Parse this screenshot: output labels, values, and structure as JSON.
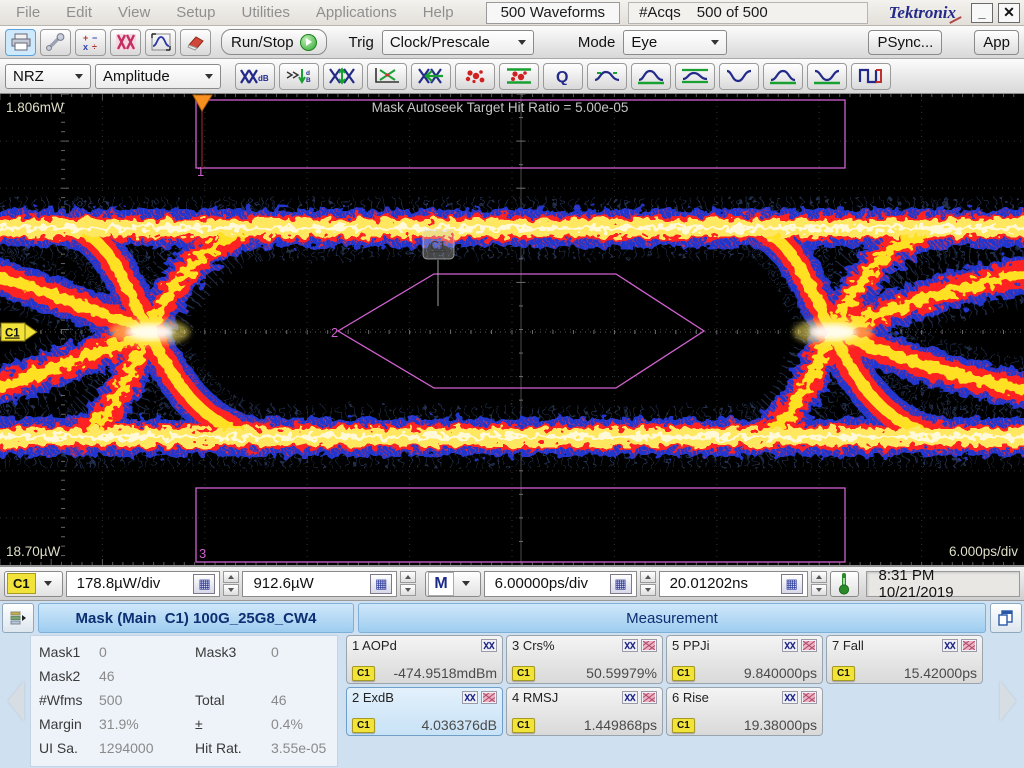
{
  "titlebar": {
    "menus": [
      "File",
      "Edit",
      "View",
      "Setup",
      "Utilities",
      "Applications",
      "Help"
    ],
    "waveforms": "500 Waveforms",
    "acqs_label": "#Acqs",
    "acqs_value": "500 of 500",
    "brand": "Tektronix",
    "minimize_label": "_",
    "close_label": "✕"
  },
  "toolbar_main": {
    "run_stop_label": "Run/Stop",
    "trig_label": "Trig",
    "trig_source": "Clock/Prescale",
    "mode_label": "Mode",
    "mode_value": "Eye",
    "psync_label": "PSync...",
    "app_label": "App"
  },
  "toolbar_measure": {
    "signal_type": "NRZ",
    "category": "Amplitude",
    "q_label": "Q",
    "db_label": "dB"
  },
  "display": {
    "top_left_scale": "1.806mW",
    "bottom_left_scale": "18.70µW",
    "bottom_right_scale": "6.000ps/div",
    "autoseek_text": "Mask Autoseek Target Hit Ratio = 5.00e-05",
    "channel_marker": "C1",
    "cursor_tag": "C1",
    "mask_region_1": "1",
    "mask_region_2": "2",
    "mask_region_3": "3",
    "colors": {
      "trace_core": "#ffe020",
      "trace_mid": "#ff2020",
      "trace_outer": "#2238d8",
      "mask": "#d060d0",
      "background": "#000000"
    }
  },
  "statusbar": {
    "channel": "C1",
    "vertical_scale": "178.8µW/div",
    "vertical_offset": "912.6µW",
    "timebase": "M",
    "horizontal_scale": "6.00000ps/div",
    "horizontal_position": "20.01202ns",
    "datetime": "8:31 PM 10/21/2019"
  },
  "mask_panel": {
    "title": "Mask (Main  C1) 100G_25G8_CW4",
    "rows": [
      {
        "l1": "Mask1",
        "v1": "0",
        "l2": "Mask3",
        "v2": "0"
      },
      {
        "l1": "Mask2",
        "v1": "46",
        "l2": "",
        "v2": ""
      },
      {
        "l1": "#Wfms",
        "v1": "500",
        "l2": "Total",
        "v2": "46"
      },
      {
        "l1": "Margin",
        "v1": "31.9%",
        "l2": "±",
        "v2": "0.4%"
      },
      {
        "l1": "UI Sa.",
        "v1": "1294000",
        "l2": "Hit Rat.",
        "v2": "3.55e-05"
      }
    ]
  },
  "measurement_panel": {
    "title": "Measurement",
    "measurements": [
      {
        "name": "1 AOPd",
        "source": "C1",
        "value": "-474.9518mdBm"
      },
      {
        "name": "2 ExdB",
        "source": "C1",
        "value": "4.036376dB"
      },
      {
        "name": "3 Crs%",
        "source": "C1",
        "value": "50.59979%"
      },
      {
        "name": "4 RMSJ",
        "source": "C1",
        "value": "1.449868ps"
      },
      {
        "name": "5 PPJi",
        "source": "C1",
        "value": "9.840000ps"
      },
      {
        "name": "6 Rise",
        "source": "C1",
        "value": "19.38000ps"
      },
      {
        "name": "7 Fall",
        "source": "C1",
        "value": "15.42000ps"
      }
    ]
  }
}
